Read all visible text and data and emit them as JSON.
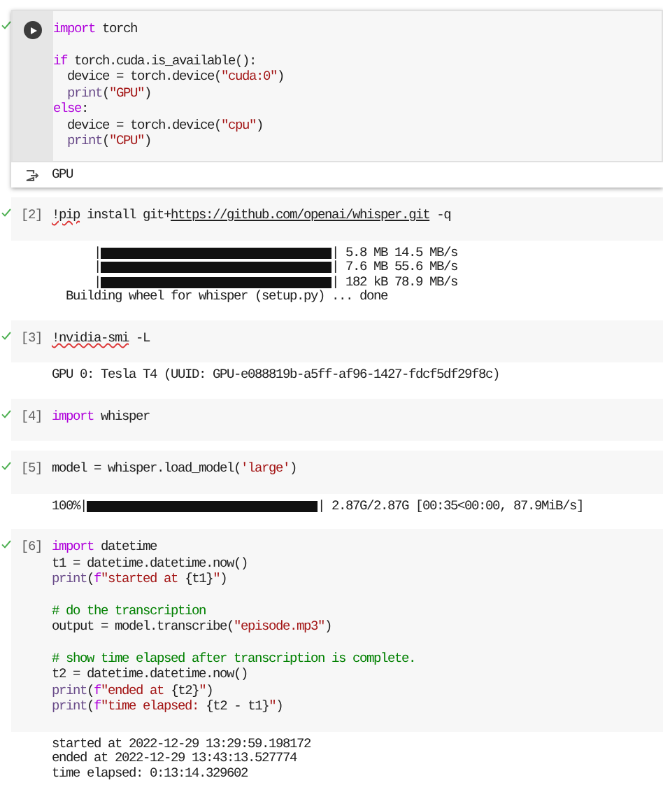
{
  "cells": [
    {
      "prompt": {
        "kind": "run"
      },
      "focused": true,
      "executed": true,
      "code_groups": [
        [
          [
            {
              "kind": "kw",
              "text": "import"
            },
            {
              "kind": "p",
              "text": " torch"
            }
          ]
        ],
        [
          [
            {
              "kind": "kw",
              "text": "if"
            },
            {
              "kind": "p",
              "text": " torch.cuda.is_available():"
            }
          ],
          [
            {
              "kind": "p",
              "text": "  device = torch.device("
            },
            {
              "kind": "str",
              "text": "\"cuda:0\""
            },
            {
              "kind": "p",
              "text": ")"
            }
          ],
          [
            {
              "kind": "fn",
              "text": "  print"
            },
            {
              "kind": "p",
              "text": "("
            },
            {
              "kind": "str",
              "text": "\"GPU\""
            },
            {
              "kind": "p",
              "text": ")"
            }
          ],
          [
            {
              "kind": "kw",
              "text": "else"
            },
            {
              "kind": "p",
              "text": ":"
            }
          ],
          [
            {
              "kind": "p",
              "text": "  device = torch.device("
            },
            {
              "kind": "str",
              "text": "\"cpu\""
            },
            {
              "kind": "p",
              "text": ")"
            }
          ],
          [
            {
              "kind": "fn",
              "text": "  print"
            },
            {
              "kind": "p",
              "text": "("
            },
            {
              "kind": "str",
              "text": "\"CPU\""
            },
            {
              "kind": "p",
              "text": ")"
            }
          ]
        ]
      ],
      "output": [
        {
          "kind": "text",
          "text": "GPU"
        }
      ]
    },
    {
      "prompt": {
        "kind": "count",
        "text": "[2]"
      },
      "focused": false,
      "executed": true,
      "code_groups": [
        [
          [
            {
              "kind": "shell",
              "text": "!pip"
            },
            {
              "kind": "p",
              "text": " install git+"
            },
            {
              "kind": "link",
              "text": "https://github.com/openai/whisper.git"
            },
            {
              "kind": "p",
              "text": " -q"
            }
          ]
        ]
      ],
      "output": [
        {
          "kind": "bar",
          "prefix": "      |",
          "level": 1,
          "reading": "| 5.8 MB 14.5 MB/s"
        },
        {
          "kind": "bar",
          "prefix": "      |",
          "level": 1,
          "reading": "| 7.6 MB 55.6 MB/s"
        },
        {
          "kind": "bar",
          "prefix": "      |",
          "level": 1,
          "reading": "| 182 kB 78.9 MB/s"
        },
        {
          "kind": "text",
          "text": "  Building wheel for whisper (setup.py) ... done"
        }
      ]
    },
    {
      "prompt": {
        "kind": "count",
        "text": "[3]"
      },
      "focused": false,
      "executed": true,
      "code_groups": [
        [
          [
            {
              "kind": "shell",
              "text": "!nvidia-smi"
            },
            {
              "kind": "p",
              "text": " -L"
            }
          ]
        ]
      ],
      "output": [
        {
          "kind": "text",
          "text": "GPU 0: Tesla T4 (UUID: GPU-e088819b-a5ff-af96-1427-fdcf5df29f8c)"
        }
      ]
    },
    {
      "prompt": {
        "kind": "count",
        "text": "[4]"
      },
      "focused": false,
      "executed": true,
      "code_groups": [
        [
          [
            {
              "kind": "kw",
              "text": "import"
            },
            {
              "kind": "p",
              "text": " whisper"
            }
          ]
        ]
      ]
    },
    {
      "prompt": {
        "kind": "count",
        "text": "[5]"
      },
      "focused": false,
      "executed": true,
      "code_groups": [
        [
          [
            {
              "kind": "p",
              "text": "model = whisper.load_model("
            },
            {
              "kind": "str",
              "text": "'large'"
            },
            {
              "kind": "p",
              "text": ")"
            }
          ]
        ]
      ],
      "output": [
        {
          "kind": "bar",
          "prefix": "100%|",
          "level": 1,
          "reading": "| 2.87G/2.87G [00:35<00:00, 87.9MiB/s]"
        }
      ]
    },
    {
      "prompt": {
        "kind": "count",
        "text": "[6]"
      },
      "focused": false,
      "executed": true,
      "code_groups": [
        [
          [
            {
              "kind": "kw",
              "text": "import"
            },
            {
              "kind": "p",
              "text": " datetime"
            }
          ],
          [
            {
              "kind": "p",
              "text": "t1 = datetime.datetime.now()"
            }
          ],
          [
            {
              "kind": "fn",
              "text": "print"
            },
            {
              "kind": "p",
              "text": "("
            },
            {
              "kind": "kw",
              "text": "f"
            },
            {
              "kind": "str",
              "text": "\"started at "
            },
            {
              "kind": "p",
              "text": "{t1}"
            },
            {
              "kind": "str",
              "text": "\""
            },
            {
              "kind": "p",
              "text": ")"
            }
          ]
        ],
        [
          [
            {
              "kind": "com",
              "text": "# do the transcription"
            }
          ],
          [
            {
              "kind": "p",
              "text": "output = model.transcribe("
            },
            {
              "kind": "str",
              "text": "\"episode.mp3\""
            },
            {
              "kind": "p",
              "text": ")"
            }
          ]
        ],
        [
          [
            {
              "kind": "com",
              "text": "# show time elapsed after transcription is complete."
            }
          ],
          [
            {
              "kind": "p",
              "text": "t2 = datetime.datetime.now()"
            }
          ],
          [
            {
              "kind": "fn",
              "text": "print"
            },
            {
              "kind": "p",
              "text": "("
            },
            {
              "kind": "kw",
              "text": "f"
            },
            {
              "kind": "str",
              "text": "\"ended at "
            },
            {
              "kind": "p",
              "text": "{t2}"
            },
            {
              "kind": "str",
              "text": "\""
            },
            {
              "kind": "p",
              "text": ")"
            }
          ],
          [
            {
              "kind": "fn",
              "text": "print"
            },
            {
              "kind": "p",
              "text": "("
            },
            {
              "kind": "kw",
              "text": "f"
            },
            {
              "kind": "str",
              "text": "\"time elapsed: "
            },
            {
              "kind": "p",
              "text": "{t2 - t1}"
            },
            {
              "kind": "str",
              "text": "\""
            },
            {
              "kind": "p",
              "text": ")"
            }
          ]
        ]
      ],
      "output": [
        {
          "kind": "text",
          "text": "started at 2022-12-29 13:29:59.198172"
        },
        {
          "kind": "text",
          "text": "ended at 2022-12-29 13:43:13.527774"
        },
        {
          "kind": "text",
          "text": "time elapsed: 0:13:14.329602"
        }
      ]
    }
  ]
}
